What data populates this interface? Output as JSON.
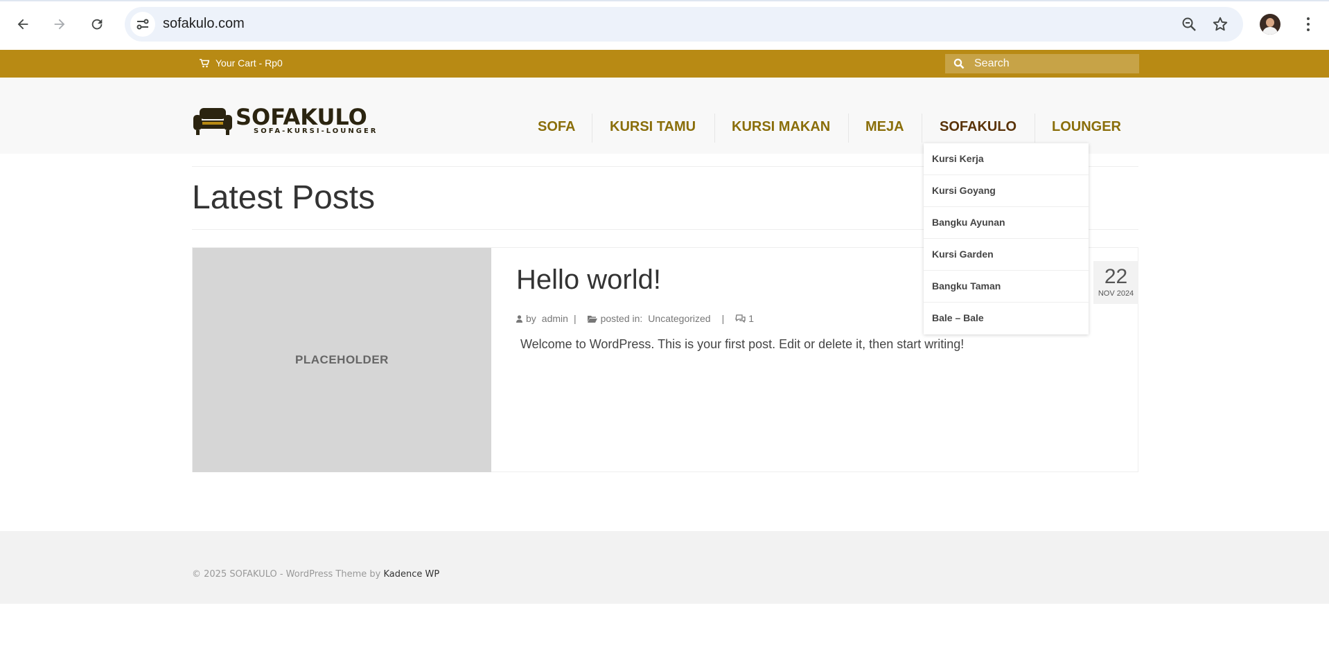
{
  "browser": {
    "url": "sofakulo.com"
  },
  "topbar": {
    "cart_label": "Your Cart - Rp0",
    "search_placeholder": "Search",
    "accent_color": "#b88a14"
  },
  "header": {
    "logo_text": "SOFAKULO",
    "logo_tagline": "SOFA-KURSI-LOUNGER",
    "menu": [
      {
        "label": "SOFA"
      },
      {
        "label": "KURSI TAMU"
      },
      {
        "label": "KURSI MAKAN"
      },
      {
        "label": "MEJA"
      },
      {
        "label": "SOFAKULO"
      },
      {
        "label": "LOUNGER"
      }
    ],
    "dropdown": [
      {
        "label": "Kursi Kerja"
      },
      {
        "label": "Kursi Goyang"
      },
      {
        "label": "Bangku Ayunan"
      },
      {
        "label": "Kursi Garden"
      },
      {
        "label": "Bangku Taman"
      },
      {
        "label": "Bale – Bale"
      }
    ]
  },
  "main": {
    "page_title": "Latest Posts",
    "post": {
      "thumbnail_label": "PLACEHOLDER",
      "title": "Hello world!",
      "author_prefix": "by",
      "author": "admin",
      "divider": "|",
      "posted_in_label": "posted in:",
      "category": "Uncategorized",
      "comment_count": "1",
      "excerpt": "Welcome to WordPress. This is your first post. Edit or delete it, then start writing!",
      "date_day": "22",
      "date_month_year": "NOV 2024"
    }
  },
  "footer": {
    "copyright": "© 2025 SOFAKULO - WordPress Theme by",
    "theme_link": "Kadence WP"
  }
}
